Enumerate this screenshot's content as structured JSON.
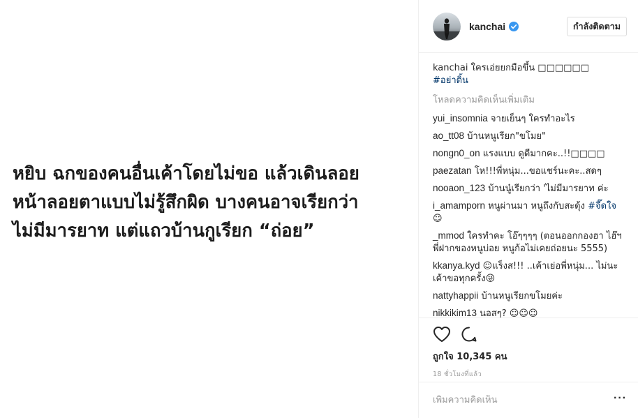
{
  "media": {
    "lines": [
      "หยิบ ฉกของคนอื่นเค้าโดยไม่ขอ แล้วเดินลอย",
      "หน้าลอยตาแบบไม่รู้สึกผิด บางคนอาจเรียกว่า",
      "ไม่มีมารยาท แต่แถวบ้านกูเรียก “ถ่อย”"
    ]
  },
  "header": {
    "username": "kanchai",
    "verified_icon": "verified-badge-icon",
    "follow_label": "กำลังติดตาม"
  },
  "caption": {
    "username": "kanchai",
    "text": " ใครเอ่ยยกมือขึ้น □□□□□□",
    "hashtag": "#อย่าดิ้น"
  },
  "load_more": "โหลดความคิดเห็นเพิ่มเติม",
  "comments": [
    {
      "user": "yui_insomnia",
      "text": " จายเย็นๆ ใครทำอะไร"
    },
    {
      "user": "ao_tt08",
      "text": " บ้านหนูเรียก\"ขโมย\""
    },
    {
      "user": "nongn0_on",
      "text": " แรงแบบ ดูดีมากคะ..!!□□□□"
    },
    {
      "user": "paezatan",
      "text": " โห!!!พี่หนุ่ม...ขอแชร์นะคะ..สดๆ"
    },
    {
      "user": "nooaon_123",
      "text": " บ้านนู๋เรียกว่า 'ไม่มีมารยาท ค่ะ"
    },
    {
      "user": "i_amamporn",
      "text": " หนูผ่านมา หนูถึงกับสะดุ้ง ",
      "hashtag": "#จี๊ดใจ",
      "tail": "☺"
    },
    {
      "user": "_mmod",
      "text": " ใครทำคะ โอ๊ๆๆๆๆ (ตอนออกกองฮา ไฮ๊ฯ พี่ฝากของหนูบ่อย หนูก้อไม่เคยถ่อยนะ 5555)"
    },
    {
      "user": "kkanya.kyd",
      "text": " ☺แร็งส!!! ..เค้าเย่อพี่หนุ่ม... ไม่นะเค้าขอทุกครั้ง😜"
    },
    {
      "user": "nattyhappii",
      "text": " บ้านหนูเรียกขโมยค่ะ"
    },
    {
      "user": "nikkikim13",
      "text": " นอสๆ? ☺☺☺"
    }
  ],
  "actions": {
    "like_icon": "heart-icon",
    "comment_icon": "comment-bubble-icon"
  },
  "likes": "ถูกใจ 10,345 คน",
  "timestamp": "18 ชั่วโมงที่แล้ว",
  "add_comment": {
    "placeholder": "เพิ่มความคิดเห็น",
    "more_icon": "ellipsis-icon"
  }
}
